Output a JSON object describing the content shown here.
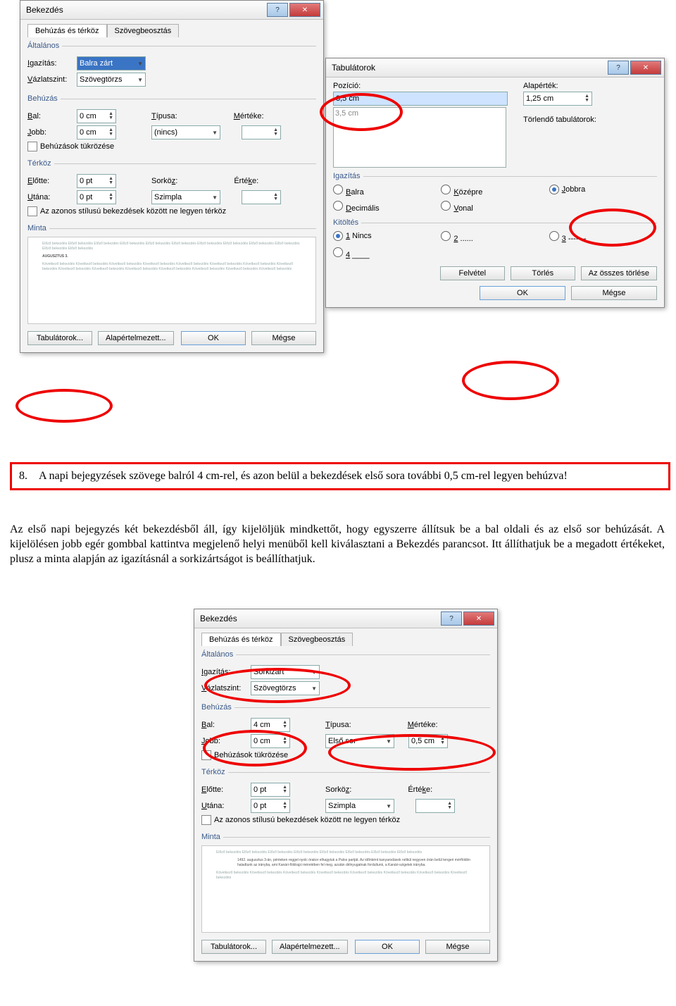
{
  "para1": {
    "title": "Bekezdés",
    "tabs": {
      "t1": "Behúzás és térköz",
      "t2": "Szövegbeosztás"
    },
    "groups": {
      "general": "Általános",
      "indent": "Behúzás",
      "spacing": "Térköz",
      "preview": "Minta"
    },
    "labels": {
      "align": "Igazítás:",
      "outline": "Vázlatszint:",
      "left": "Bal:",
      "right": "Jobb:",
      "special": "Típusa:",
      "by": "Mértéke:",
      "before": "Előtte:",
      "after": "Utána:",
      "linespace": "Sorköz:",
      "at": "Értéke:"
    },
    "values": {
      "align": "Balra zárt",
      "outline": "Szövegtörzs",
      "left": "0 cm",
      "right": "0 cm",
      "special": "(nincs)",
      "by": "",
      "before": "0 pt",
      "after": "0 pt",
      "linespace": "Szimpla",
      "at": ""
    },
    "checkboxes": {
      "mirror": "Behúzások tükrözése",
      "nospace": "Az azonos stílusú bekezdések között ne legyen térköz"
    },
    "buttons": {
      "tabs": "Tabulátorok...",
      "default": "Alapértelmezett...",
      "ok": "OK",
      "cancel": "Mégse"
    }
  },
  "tabdlg": {
    "title": "Tabulátorok",
    "labels": {
      "pos": "Pozíció:",
      "default": "Alapérték:",
      "clear": "Törlendő tabulátorok:",
      "align": "Igazítás",
      "fill": "Kitöltés"
    },
    "values": {
      "pos": "3,5 cm",
      "listitem": "3,5 cm",
      "default": "1,25 cm"
    },
    "align": {
      "left": "Balra",
      "center": "Középre",
      "right": "Jobbra",
      "decimal": "Decimális",
      "bar": "Vonal"
    },
    "fill": {
      "f1": "1 Nincs",
      "f2": "2 ......",
      "f3": "3 -------",
      "f4": "4 ____"
    },
    "buttons": {
      "set": "Felvétel",
      "clear": "Törlés",
      "clearall": "Az összes törlése",
      "ok": "OK",
      "cancel": "Mégse"
    }
  },
  "step8": {
    "num": "8.",
    "text": "A napi bejegyzések szövege balról 4 cm-rel, és azon belül a bekezdések első sora további 0,5 cm-rel legyen behúzva!"
  },
  "bodytext": "Az első napi bejegyzés két bekezdésből áll, így kijelöljük mindkettőt, hogy egyszerre állítsuk be a bal oldali és az első sor behúzását. A kijelölésen jobb egér gombbal kattintva megjelenő helyi menüből kell kiválasztani a Bekezdés parancsot. Itt állíthatjuk be a megadott értékeket, plusz a minta alapján az igazításnál a sorkizártságot is beállíthatjuk.",
  "para2": {
    "title": "Bekezdés",
    "values": {
      "align": "Sorkizárt",
      "outline": "Szövegtörzs",
      "left": "4 cm",
      "right": "0 cm",
      "special": "Első sor",
      "by": "0,5 cm",
      "before": "0 pt",
      "after": "0 pt",
      "linespace": "Szimpla"
    }
  }
}
